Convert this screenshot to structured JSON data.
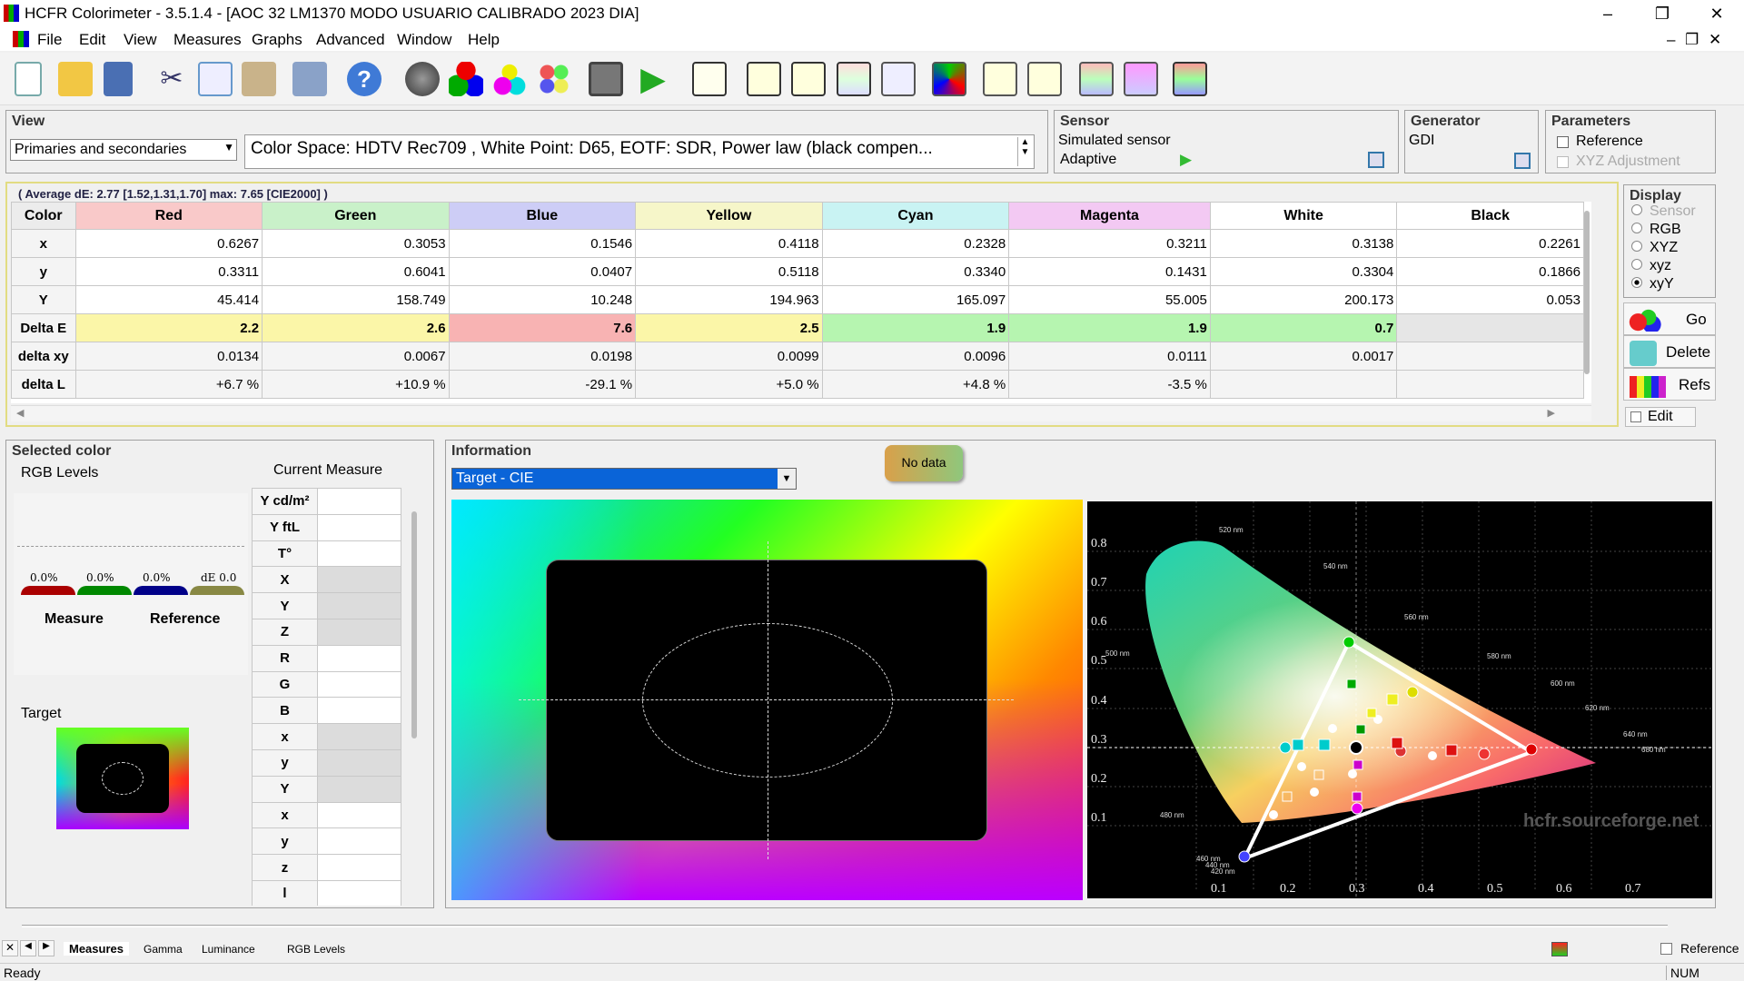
{
  "window": {
    "title": "HCFR Colorimeter - 3.5.1.4 - [AOC 32 LM1370 MODO USUARIO CALIBRADO 2023 DIA]",
    "minimize": "–",
    "restore": "❐",
    "close": "✕",
    "mdi_min": "–",
    "mdi_restore": "❐",
    "mdi_close": "✕"
  },
  "menu": [
    "File",
    "Edit",
    "View",
    "Measures",
    "Graphs",
    "Advanced",
    "Window",
    "Help"
  ],
  "toolbar": [
    "new-icon",
    "open-icon",
    "save-icon",
    "cut-icon",
    "copy-icon",
    "paste-icon",
    "print-icon",
    "help-icon",
    "sensor-icon",
    "rgb-icon",
    "colors-icon",
    "palette-icon",
    "camera-icon",
    "play-icon",
    "gray-graph-icon",
    "gamma-graph-icon",
    "luminance-graph-icon",
    "rgb-graph-icon",
    "temp-graph-icon",
    "cie-graph-icon",
    "sat-graph-icon",
    "sat2-graph-icon",
    "rgb-levels-icon",
    "sat-levels-icon",
    "monitor-icon"
  ],
  "view": {
    "title": "View",
    "select": "Primaries and secondaries",
    "colorspace": "Color Space: HDTV Rec709 , White Point: D65, EOTF:  SDR, Power law (black compen..."
  },
  "sensor": {
    "title": "Sensor",
    "name": "Simulated sensor",
    "mode": "Adaptive"
  },
  "generator": {
    "title": "Generator",
    "name": "GDI"
  },
  "parameters": {
    "title": "Parameters",
    "reference": "Reference",
    "xyz_adjust": "XYZ Adjustment"
  },
  "display": {
    "title": "Display",
    "options": [
      "Sensor",
      "RGB",
      "XYZ",
      "xyz",
      "xyY"
    ],
    "selected": "xyY",
    "go": "Go",
    "delete": "Delete",
    "refs": "Refs",
    "edit": "Edit"
  },
  "measures": {
    "summary": "( Average dE: 2.77 [1.52,1.31,1.70] max: 7.65 [CIE2000] )",
    "columns": [
      "Color",
      "Red",
      "Green",
      "Blue",
      "Yellow",
      "Cyan",
      "Magenta",
      "White",
      "Black"
    ],
    "col_colors": [
      "#ececec",
      "#f9c9c9",
      "#c9f1c9",
      "#cdcdf6",
      "#f6f6c9",
      "#c9f3f3",
      "#f3c9f3",
      "#ffffff",
      "#ffffff"
    ],
    "rows": [
      {
        "label": "x",
        "cells": [
          "0.6267",
          "0.3053",
          "0.1546",
          "0.4118",
          "0.2328",
          "0.3211",
          "0.3138",
          "0.2261"
        ]
      },
      {
        "label": "y",
        "cells": [
          "0.3311",
          "0.6041",
          "0.0407",
          "0.5118",
          "0.3340",
          "0.1431",
          "0.3304",
          "0.1866"
        ]
      },
      {
        "label": "Y",
        "cells": [
          "45.414",
          "158.749",
          "10.248",
          "194.963",
          "165.097",
          "55.005",
          "200.173",
          "0.053"
        ]
      },
      {
        "label": "Delta E",
        "cells": [
          "2.2",
          "2.6",
          "7.6",
          "2.5",
          "1.9",
          "1.9",
          "0.7",
          ""
        ],
        "colors": [
          "#fbf6a8",
          "#fbf6a8",
          "#f8b3b3",
          "#fbf6a8",
          "#b6f5b0",
          "#b6f5b0",
          "#b6f5b0",
          "#e6e6e6"
        ]
      },
      {
        "label": "delta xy",
        "cells": [
          "0.0134",
          "0.0067",
          "0.0198",
          "0.0099",
          "0.0096",
          "0.0111",
          "0.0017",
          ""
        ]
      },
      {
        "label": "delta L",
        "cells": [
          "+6.7 %",
          "+10.9 %",
          "-29.1 %",
          "+5.0 %",
          "+4.8 %",
          "-3.5 %",
          "",
          ""
        ]
      }
    ]
  },
  "selected": {
    "title": "Selected color",
    "rgb_levels": "RGB Levels",
    "current": "Current Measure",
    "levels": [
      "0.0%",
      "0.0%",
      "0.0%",
      "dE 0.0"
    ],
    "measure": "Measure",
    "reference": "Reference",
    "target": "Target",
    "fields": [
      "Y cd/m²",
      "Y ftL",
      "T°",
      "X",
      "Y",
      "Z",
      "R",
      "G",
      "B",
      "x",
      "y",
      "Y",
      "x",
      "y",
      "z",
      "l"
    ]
  },
  "information": {
    "title": "Information",
    "select": "Target - CIE",
    "tooltip": "No data"
  },
  "cie": {
    "y_ticks": [
      "0.8",
      "0.7",
      "0.6",
      "0.5",
      "0.4",
      "0.3",
      "0.2",
      "0.1"
    ],
    "x_ticks": [
      "0.1",
      "0.2",
      "0.3",
      "0.4",
      "0.5",
      "0.6",
      "0.7"
    ],
    "watermark": "hcfr.sourceforge.net",
    "nm_labels": [
      "520 nm",
      "540 nm",
      "560 nm",
      "580 nm",
      "600 nm",
      "620 nm",
      "640 nm",
      "680 nm",
      "500 nm",
      "480 nm",
      "460 nm",
      "440 nm",
      "420 nm"
    ]
  },
  "tabs": [
    "Measures",
    "Gamma",
    "Luminance",
    "RGB Levels"
  ],
  "status": {
    "text": "Ready",
    "num": "NUM",
    "reference": "Reference"
  }
}
